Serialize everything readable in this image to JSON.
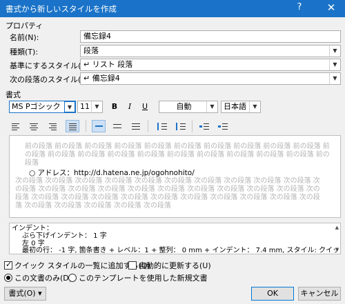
{
  "window": {
    "title": "書式から新しいスタイルを作成",
    "help": "?",
    "close": "✕"
  },
  "properties": {
    "group_label": "プロパティ",
    "name_label": "名前(N):",
    "name_value": "備忘録4",
    "type_label": "種類(T):",
    "type_value": "段落",
    "base_label": "基準にするスタイル(B):",
    "base_value": "↵ リスト 段落",
    "next_label": "次の段落のスタイル(S):",
    "next_value": "↵ 備忘録4"
  },
  "format": {
    "group_label": "書式",
    "font": "MS Pゴシック",
    "size": "11",
    "bold": "B",
    "italic": "I",
    "underline": "U",
    "color": "自動",
    "language": "日本語"
  },
  "preview": {
    "prev_text": "前の段落 前の段落 前の段落 前の段落 前の段落 前の段落 前の段落 前の段落 前の段落 前の段落 前の段落 前の段落 前の段落 前の段落 前の段落 前の段落 前の段落 前の段落 前の段落 前の段落 前の段落",
    "bullet_text": "○ アドレス：http://d.hatena.ne.jp/ogohnohito/",
    "next_text": "次の段落 次の段落 次の段落 次の段落 次の段落 次の段落 次の段落 次の段落 次の段落 次の段落 次の段落 次の段落 次の段落 次の段落 次の段落 次の段落 次の段落 次の段落 次の段落 次の段落 次の段落 次の段落 次の段落 次の段落 次の段落 次の段落 次の段落 次の段落 次の段落 次の段落 次の段落 次の段落 次の段落 次の段落 次の段落 次の段落"
  },
  "description": {
    "line1": "インデント：",
    "line2": "ぶら下げインデント： 1 字",
    "line3": "左 0 字",
    "line4": "最初の行： -1 字, 箇条書き + レベル：1 + 整列： 0 mm + インデント： 7.4 mm, スタイル: クイック スタイ"
  },
  "options": {
    "add_quick_style": "クイック スタイルの一覧に追加する(Q)",
    "auto_update": "自動的に更新する(U)",
    "this_doc_only": "この文書のみ(D)",
    "new_template": "このテンプレートを使用した新規文書"
  },
  "buttons": {
    "format": "書式(O) ▾",
    "ok": "OK",
    "cancel": "キャンセル"
  }
}
